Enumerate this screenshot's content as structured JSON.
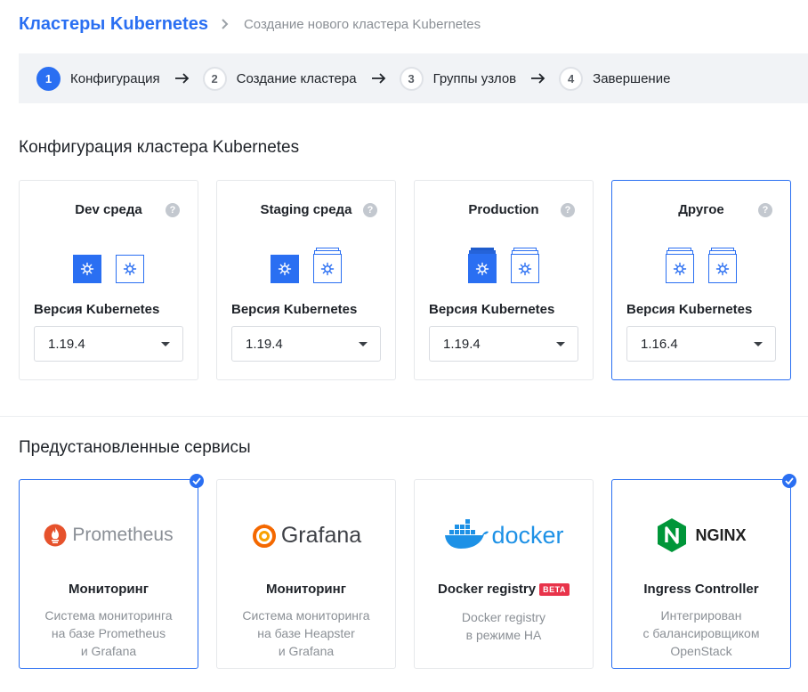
{
  "breadcrumb": {
    "root": "Кластеры Kubernetes",
    "current": "Создание нового кластера Kubernetes"
  },
  "stepper": [
    {
      "num": "1",
      "label": "Конфигурация",
      "active": true
    },
    {
      "num": "2",
      "label": "Создание кластера",
      "active": false
    },
    {
      "num": "3",
      "label": "Группы узлов",
      "active": false
    },
    {
      "num": "4",
      "label": "Завершение",
      "active": false
    }
  ],
  "config_section": {
    "title": "Конфигурация кластера Kubernetes",
    "version_label": "Версия Kubernetes",
    "help_glyph": "?",
    "cards": [
      {
        "title": "Dev среда",
        "version": "1.19.4",
        "selected": false
      },
      {
        "title": "Staging среда",
        "version": "1.19.4",
        "selected": false
      },
      {
        "title": "Production",
        "version": "1.19.4",
        "selected": false
      },
      {
        "title": "Другое",
        "version": "1.16.4",
        "selected": true
      }
    ]
  },
  "services_section": {
    "title": "Предустановленные сервисы",
    "cards": [
      {
        "logo_text": "Prometheus",
        "title": "Мониторинг",
        "desc": [
          "Система мониторинга",
          "на базе Prometheus",
          "и Grafana"
        ],
        "selected": true
      },
      {
        "logo_text": "Grafana",
        "title": "Мониторинг",
        "desc": [
          "Система мониторинга",
          "на базе Heapster",
          "и Grafana"
        ],
        "selected": false
      },
      {
        "logo_text": "docker",
        "title": "Docker registry",
        "badge": "BETA",
        "desc": [
          "Docker registry",
          "в режиме HA"
        ],
        "selected": false
      },
      {
        "logo_text": "NGINX",
        "title": "Ingress Controller",
        "desc": [
          "Интегрирован",
          "с балансировщиком",
          "OpenStack"
        ],
        "selected": true
      }
    ]
  },
  "colors": {
    "accent": "#2a6ff2",
    "beta": "#e8334a",
    "prometheus": "#e6522c",
    "grafana": "#f46800",
    "docker": "#1d91e6",
    "nginx": "#009639"
  }
}
